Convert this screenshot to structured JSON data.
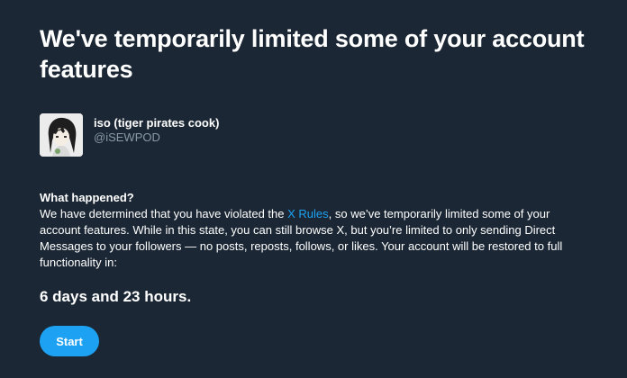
{
  "page": {
    "title": "We've temporarily limited some of your account features"
  },
  "account": {
    "display_name": "iso (tiger pirates cook)",
    "handle": "@iSEWPOD",
    "avatar_icon": "user-avatar"
  },
  "what_happened": {
    "heading": "What happened?",
    "body_before_link": "We have determined that you have violated the ",
    "link_text": "X Rules",
    "body_after_link": ", so we’ve temporarily limited some of your account features. While in this state, you can still browse X, but you’re limited to only sending Direct Messages to your followers — no posts, reposts, follows, or likes. Your account will be restored to full functionality in:"
  },
  "countdown": "6 days and 23 hours.",
  "actions": {
    "start_label": "Start"
  },
  "colors": {
    "background": "#1b2734",
    "accent": "#1da1f2",
    "muted_text": "#8899a6"
  }
}
